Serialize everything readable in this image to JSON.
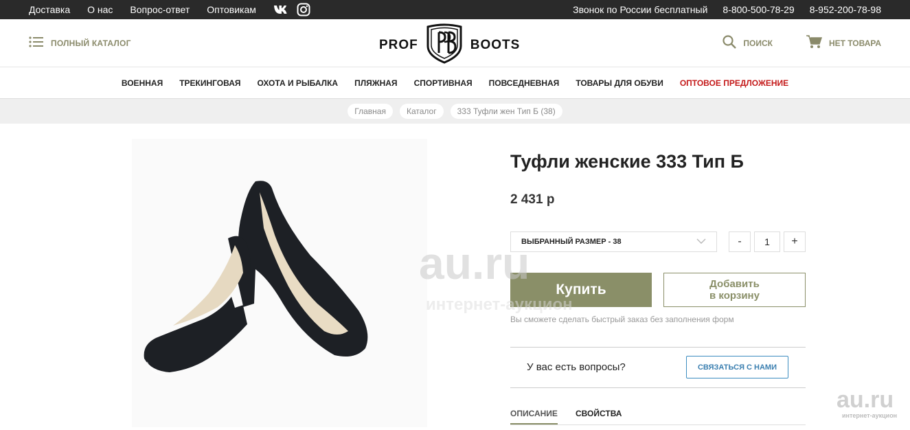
{
  "topbar": {
    "links": [
      "Доставка",
      "О нас",
      "Вопрос-ответ",
      "Оптовикам"
    ],
    "call_text": "Звонок по России бесплатный",
    "phone1": "8-800-500-78-29",
    "phone2": "8-952-200-78-98"
  },
  "header": {
    "catalog_label": "ПОЛНЫЙ КАТАЛОГ",
    "logo_left": "PROF",
    "logo_right": "BOOTS",
    "search_label": "ПОИСК",
    "cart_label": "НЕТ ТОВАРА"
  },
  "nav": {
    "items": [
      "ВОЕННАЯ",
      "ТРЕКИНГОВАЯ",
      "ОХОТА И РЫБАЛКА",
      "ПЛЯЖНАЯ",
      "СПОРТИВНАЯ",
      "ПОВСЕДНЕВНАЯ",
      "ТОВАРЫ ДЛЯ ОБУВИ"
    ],
    "accent_item": "ОПТОВОЕ ПРЕДЛОЖЕНИЕ"
  },
  "breadcrumbs": [
    "Главная",
    "Каталог",
    "333 Туфли жен Тип Б (38)"
  ],
  "product": {
    "title": "Туфли женские 333 Тип Б",
    "price": "2 431 р",
    "size_label": "ВЫБРАННЫЙ РАЗМЕР - 38",
    "quantity": "1",
    "minus": "-",
    "plus": "+",
    "buy_label": "Купить",
    "add_cart_label": "Добавить\nв корзину",
    "note": "Вы сможете сделать быстрый заказ без заполнения форм",
    "questions_label": "У вас есть вопросы?",
    "contact_label": "СВЯЗАТЬСЯ С НАМИ",
    "tab_description": "ОПИСАНИЕ",
    "tab_properties": "СВОЙСТВА"
  },
  "watermark": {
    "main": "au.ru",
    "sub": "интернет-аукцион"
  },
  "colors": {
    "accent": "#8a8f68",
    "topbar": "#2a2a2a",
    "red": "#c41a1a",
    "link_blue": "#3b7fb0"
  }
}
